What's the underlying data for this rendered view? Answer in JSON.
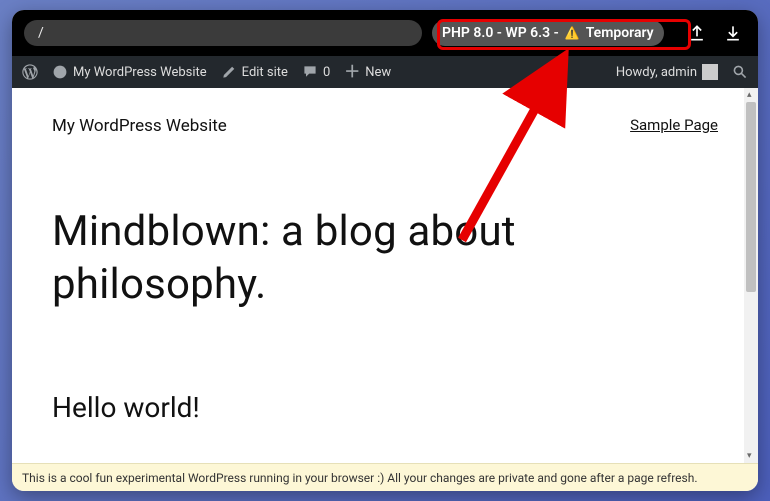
{
  "topbar": {
    "url": "/",
    "env_badge": {
      "php_wp": "PHP 8.0 - WP 6.3 -",
      "temp": "Temporary"
    }
  },
  "wpbar": {
    "site_name": "My WordPress Website",
    "edit_site": "Edit site",
    "comments_count": "0",
    "new_label": "New",
    "howdy": "Howdy, admin"
  },
  "page": {
    "site_title": "My WordPress Website",
    "nav_link": "Sample Page",
    "hero": "Mindblown: a blog about philosophy.",
    "post_title": "Hello world!"
  },
  "notice": "This is a cool fun experimental WordPress running in your browser :) All your changes are private and gone after a page refresh."
}
